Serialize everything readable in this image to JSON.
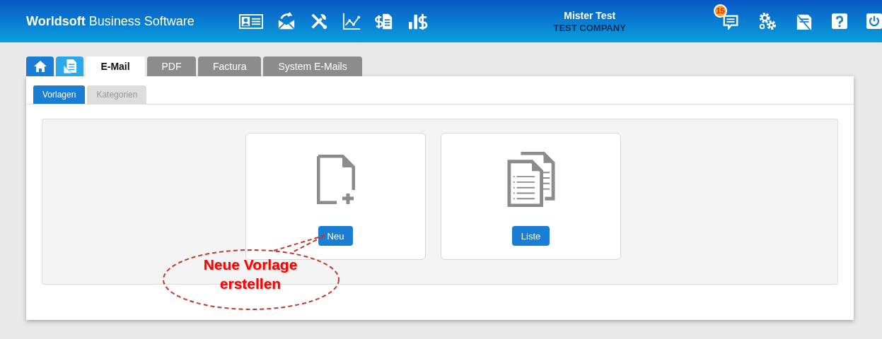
{
  "header": {
    "brand_bold": "Worldsoft",
    "brand_rest": "Business Software",
    "toolbar": [
      {
        "kind": "contact-card"
      },
      {
        "kind": "mail-reply"
      },
      {
        "kind": "tools"
      },
      {
        "kind": "chart"
      },
      {
        "kind": "invoice"
      },
      {
        "kind": "revenue"
      }
    ],
    "user": {
      "name": "Mister Test",
      "company": "TEST COMPANY"
    },
    "actions": [
      {
        "kind": "chat",
        "badge": "15"
      },
      {
        "kind": "settings"
      },
      {
        "kind": "fax"
      },
      {
        "kind": "help"
      },
      {
        "kind": "power"
      }
    ]
  },
  "tabs": [
    {
      "kind": "home",
      "selected": false
    },
    {
      "kind": "documents",
      "selected": false
    },
    {
      "kind": "text",
      "label": "E-Mail",
      "selected": true
    },
    {
      "kind": "text",
      "label": "PDF",
      "selected": false
    },
    {
      "kind": "text",
      "label": "Factura",
      "selected": false
    },
    {
      "kind": "text",
      "label": "System E-Mails",
      "selected": false
    }
  ],
  "subtabs": [
    {
      "label": "Vorlagen",
      "selected": true
    },
    {
      "label": "Kategorien",
      "selected": false
    }
  ],
  "cards": [
    {
      "kind": "new-document",
      "button": "Neu"
    },
    {
      "kind": "document-list",
      "button": "Liste"
    }
  ],
  "callout": {
    "text": "Neue Vorlage erstellen"
  }
}
